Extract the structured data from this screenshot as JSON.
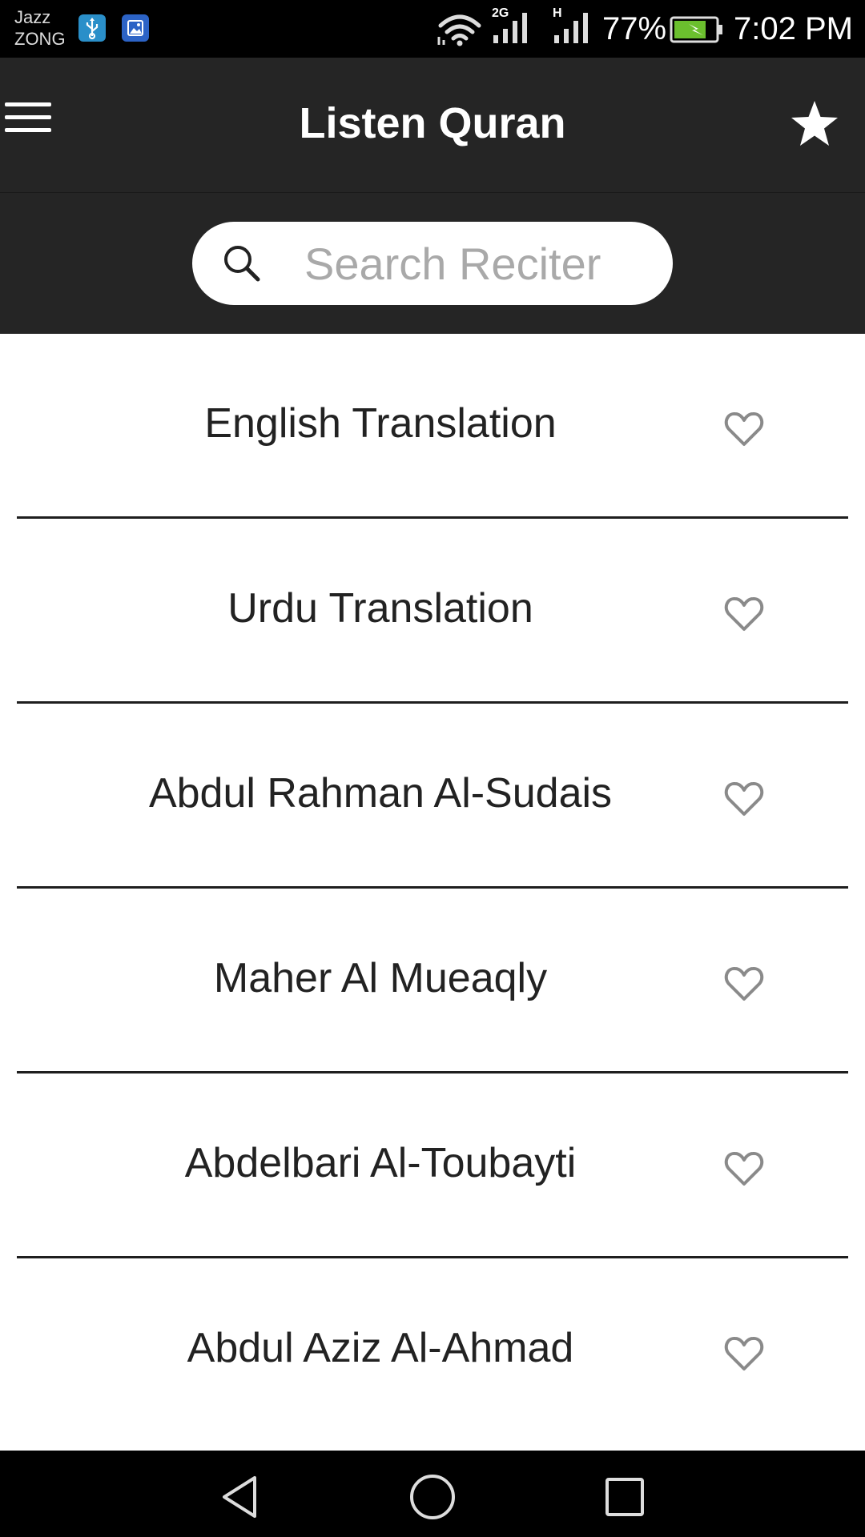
{
  "status_bar": {
    "carrier_line1": "Jazz",
    "carrier_line2": "ZONG",
    "network_2g": "2G",
    "network_h": "H",
    "battery_percent": "77%",
    "battery_level": 0.77,
    "time": "7:02 PM",
    "icons": [
      "usb-icon",
      "gallery-icon",
      "wifi-icon",
      "signal-icon",
      "signal-icon",
      "battery-charging-icon"
    ]
  },
  "app_bar": {
    "title": "Listen Quran",
    "menu_icon": "menu-icon",
    "favorites_icon": "star-icon"
  },
  "search": {
    "placeholder": "Search Reciter",
    "value": "",
    "icon": "search-icon"
  },
  "reciters": [
    {
      "label": "English Translation",
      "favorite": false
    },
    {
      "label": "Urdu Translation",
      "favorite": false
    },
    {
      "label": "Abdul Rahman Al-Sudais",
      "favorite": false
    },
    {
      "label": "Maher Al Mueaqly",
      "favorite": false
    },
    {
      "label": "Abdelbari Al-Toubayti",
      "favorite": false
    },
    {
      "label": "Abdul Aziz Al-Ahmad",
      "favorite": false
    }
  ],
  "nav_bar": {
    "icons": [
      "back-icon",
      "home-icon",
      "recents-icon"
    ]
  },
  "colors": {
    "status_bar": "#000000",
    "app_bar": "#252525",
    "list_text": "#222222",
    "heart": "#8a8a8a",
    "placeholder": "#a9a9a9",
    "battery": "#6bbf2e"
  }
}
